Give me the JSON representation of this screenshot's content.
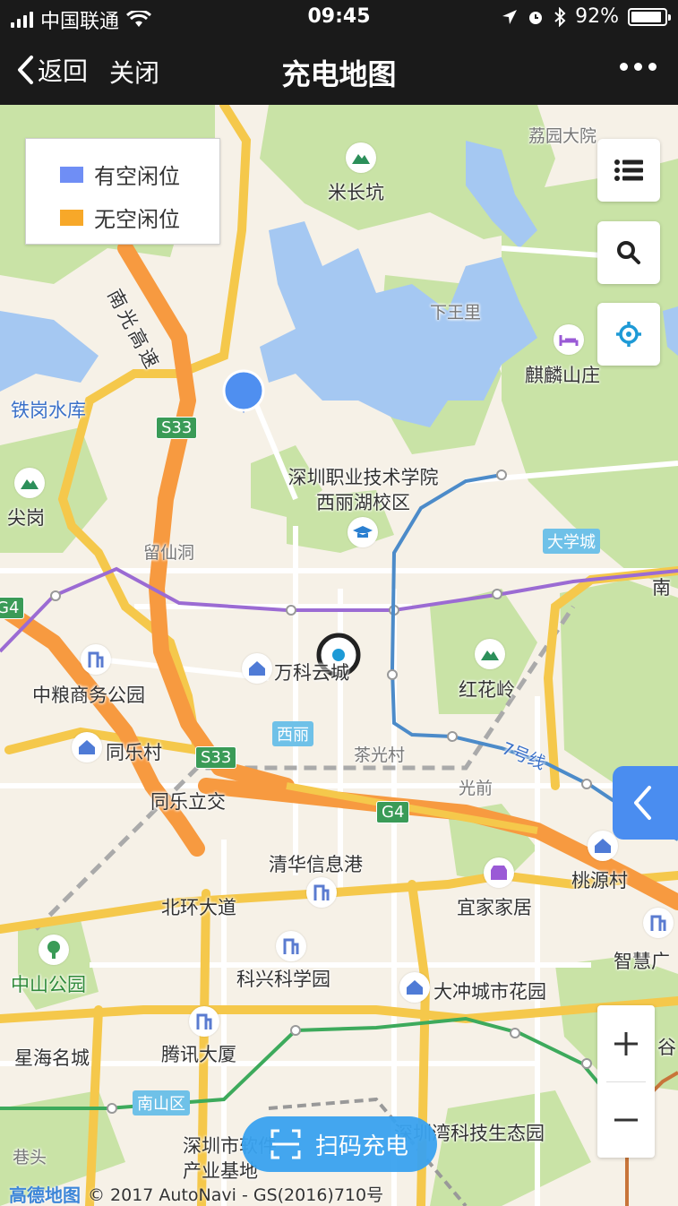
{
  "status_bar": {
    "carrier": "中国联通",
    "time": "09:45",
    "battery_percent": "92%",
    "battery_level": 0.92
  },
  "nav": {
    "back_label": "返回",
    "close_label": "关闭",
    "title": "充电地图"
  },
  "legend": {
    "items": [
      {
        "label": "有空闲位",
        "color": "#6f8ef5"
      },
      {
        "label": "无空闲位",
        "color": "#f7a829"
      }
    ]
  },
  "map": {
    "labels": {
      "lizhiyuan": "荔园大院",
      "michangkeng": "米长坑",
      "nanguang_gaosu": "南光高速",
      "xiawangli": "下王里",
      "qilin_shanzhuang": "麒麟山庄",
      "tiegang_shuiku": "铁岗水库",
      "s33_a": "S33",
      "s33_b": "S33",
      "g4_a": "G4",
      "g4_b": "G4",
      "szpt": "深圳职业技术学院西丽湖校区",
      "jiangang": "尖岗",
      "liuxiandong": "留仙洞",
      "daxuecheng": "大学城",
      "nan": "南",
      "wanke_yuncheng": "万科云城",
      "zhongliang": "中粮商务公园",
      "honghualing": "红花岭",
      "xili": "西丽",
      "chaguangcun": "茶光村",
      "tongle_cun": "同乐村",
      "line7": "7号线",
      "tongle_lijiao": "同乐立交",
      "guangqian": "光前",
      "qinghua": "清华信息港",
      "taoyuancun": "桃源村",
      "beihuan": "北环大道",
      "yijia": "宜家家居",
      "zhihui": "智慧广",
      "zhongshan_gongyuan": "中山公园",
      "kexing": "科兴科学园",
      "dachong": "大冲城市花园",
      "xinghai": "星海名城",
      "tengxun": "腾讯大厦",
      "gu": "谷",
      "nanshanqu": "南山区",
      "rjjd": "深圳市软件产业基地",
      "shenzhenwan": "深圳湾科技生态园",
      "xiangtou": "巷头"
    }
  },
  "scan_button": {
    "label": "扫码充电"
  },
  "attribution": {
    "logo": "高德地图",
    "text": "© 2017 AutoNavi - GS(2016)710号"
  }
}
